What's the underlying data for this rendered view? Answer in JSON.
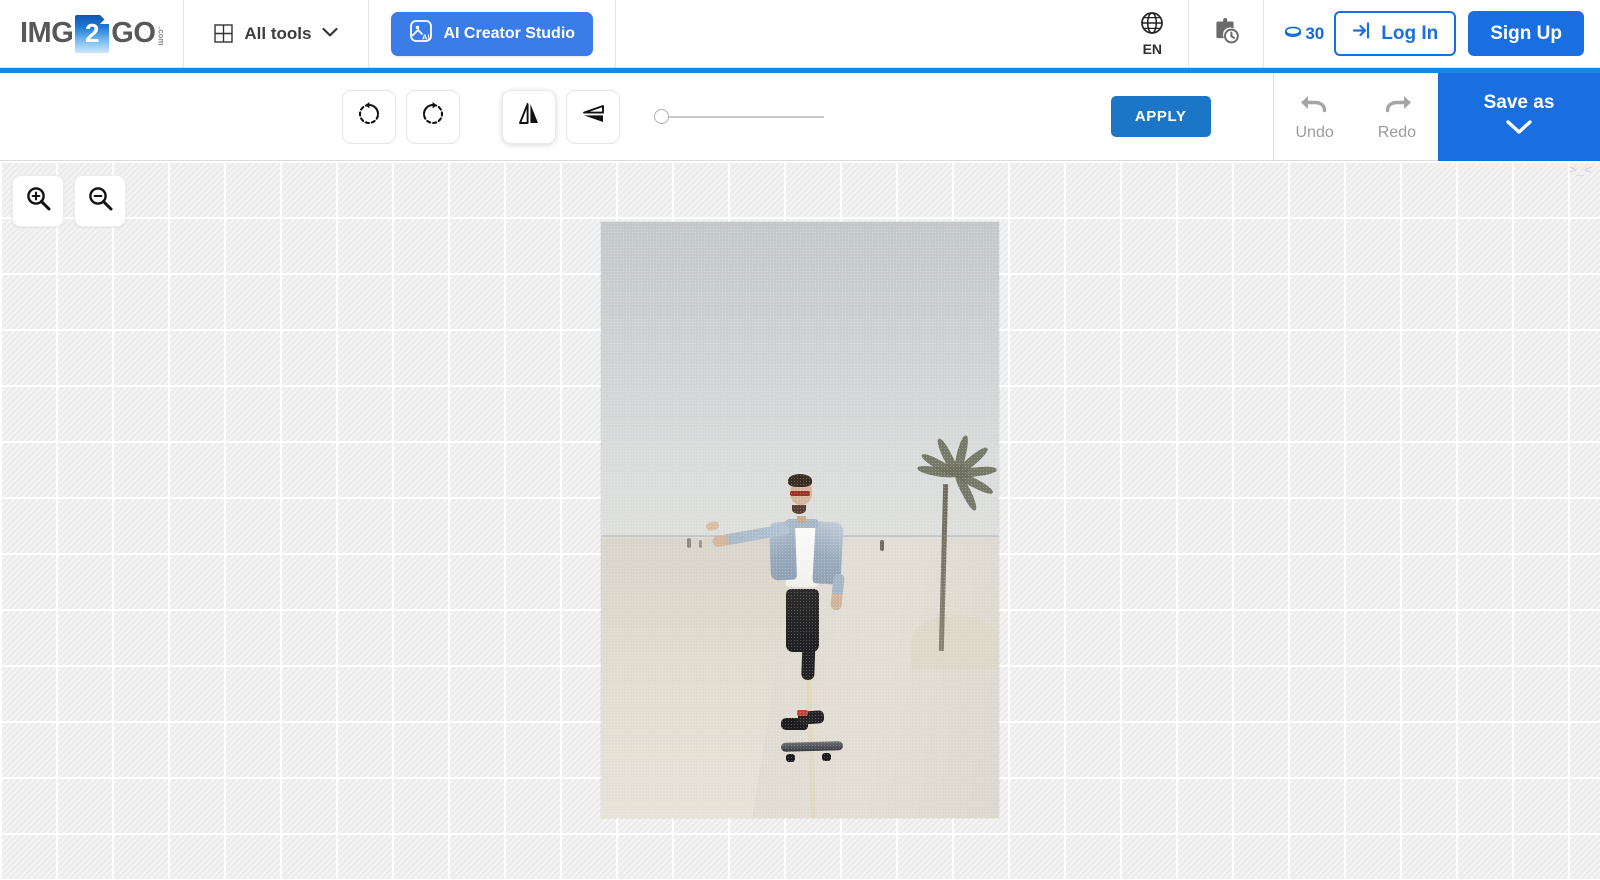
{
  "header": {
    "logo": {
      "part1": "IMG",
      "badge": "2",
      "part2": "GO",
      "tld": ".com",
      "icon": "img2go-logo-icon"
    },
    "all_tools": {
      "label": "All tools",
      "icon": "grid-icon",
      "chevron": "chevron-down-icon"
    },
    "ai_studio": {
      "label": "AI Creator Studio",
      "icon": "ai-image-icon",
      "color": "#3b7de8"
    },
    "language": {
      "code": "EN",
      "icon": "globe-icon"
    },
    "job_history": {
      "icon": "clipboard-clock-icon"
    },
    "credits": {
      "value": "30",
      "icon": "coin-icon",
      "color": "#1169d3"
    },
    "login": {
      "label": "Log In",
      "icon": "login-arrow-icon",
      "color": "#1a6fe0"
    },
    "signup": {
      "label": "Sign Up",
      "color": "#1a6fe0"
    }
  },
  "divider_bar": {
    "color": "#1a86e0"
  },
  "toolbar": {
    "rotate_left": {
      "label": "",
      "icon": "rotate-counterclockwise-icon"
    },
    "rotate_right": {
      "label": "",
      "icon": "rotate-clockwise-icon"
    },
    "flip_horizontal": {
      "label": "",
      "icon": "flip-horizontal-icon",
      "active": true
    },
    "flip_vertical": {
      "label": "",
      "icon": "flip-vertical-icon",
      "active": false
    },
    "slider": {
      "value": "0",
      "min": "0",
      "max": "100"
    },
    "apply": {
      "label": "APPLY",
      "color": "#1c76c8"
    },
    "undo": {
      "label": "Undo",
      "icon": "undo-arrow-icon",
      "disabled": true
    },
    "redo": {
      "label": "Redo",
      "icon": "redo-arrow-icon",
      "disabled": true
    },
    "save_as": {
      "label": "Save as",
      "icon": "chevron-down-icon",
      "color": "#1a6fe0"
    }
  },
  "canvas": {
    "zoom_in": {
      "icon": "magnifier-plus-icon"
    },
    "zoom_out": {
      "icon": "magnifier-minus-icon"
    },
    "corner_mark": ">_<",
    "image": {
      "alt": "Man in denim jacket riding a skateboard on a beach boardwalk with palm tree",
      "width": "398",
      "height": "596"
    }
  }
}
